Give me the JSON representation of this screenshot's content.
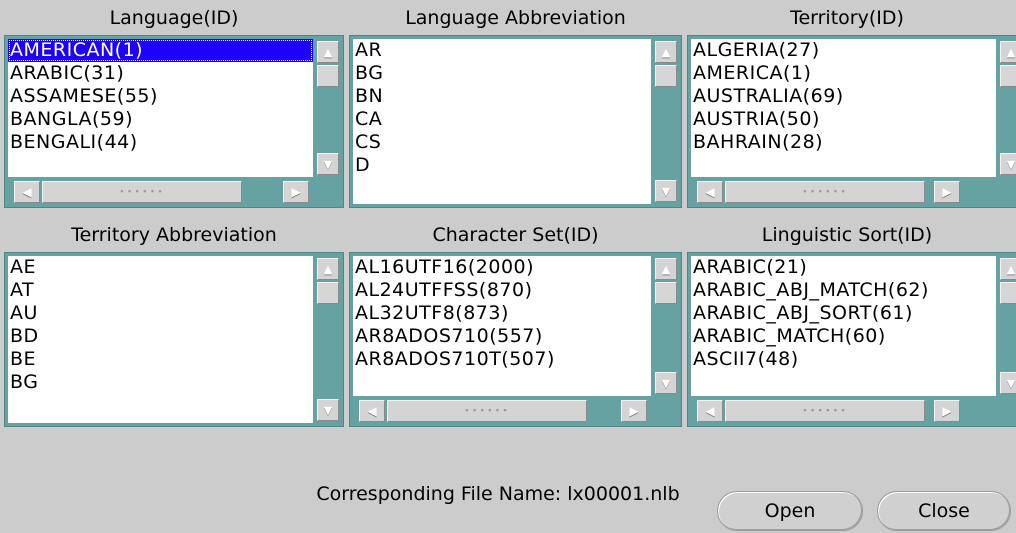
{
  "lists": {
    "language_id": {
      "title": "Language(ID)",
      "items": [
        "AMERICAN(1)",
        "ARABIC(31)",
        "ASSAMESE(55)",
        "BANGLA(59)",
        "BENGALI(44)"
      ],
      "selected_index": 0
    },
    "language_abbr": {
      "title": "Language Abbreviation",
      "items": [
        "AR",
        "BG",
        "BN",
        "CA",
        "CS",
        "D"
      ]
    },
    "territory_id": {
      "title": "Territory(ID)",
      "items": [
        "ALGERIA(27)",
        "AMERICA(1)",
        "AUSTRALIA(69)",
        "AUSTRIA(50)",
        "BAHRAIN(28)"
      ]
    },
    "territory_abbr": {
      "title": "Territory Abbreviation",
      "items": [
        "AE",
        "AT",
        "AU",
        "BD",
        "BE",
        "BG"
      ]
    },
    "charset_id": {
      "title": "Character Set(ID)",
      "items": [
        "AL16UTF16(2000)",
        "AL24UTFFSS(870)",
        "AL32UTF8(873)",
        "AR8ADOS710(557)",
        "AR8ADOS710T(507)"
      ]
    },
    "linguistic_sort_id": {
      "title": "Linguistic Sort(ID)",
      "items": [
        "ARABIC(21)",
        "ARABIC_ABJ_MATCH(62)",
        "ARABIC_ABJ_SORT(61)",
        "ARABIC_MATCH(60)",
        "ASCII7(48)"
      ]
    }
  },
  "footer": {
    "file_name_label": "Corresponding File Name: lx00001.nlb"
  },
  "buttons": {
    "open": "Open",
    "close": "Close"
  },
  "colors": {
    "background": "#cccccc",
    "list_frame": "#66a2a2",
    "selection": "#1d00ff"
  }
}
